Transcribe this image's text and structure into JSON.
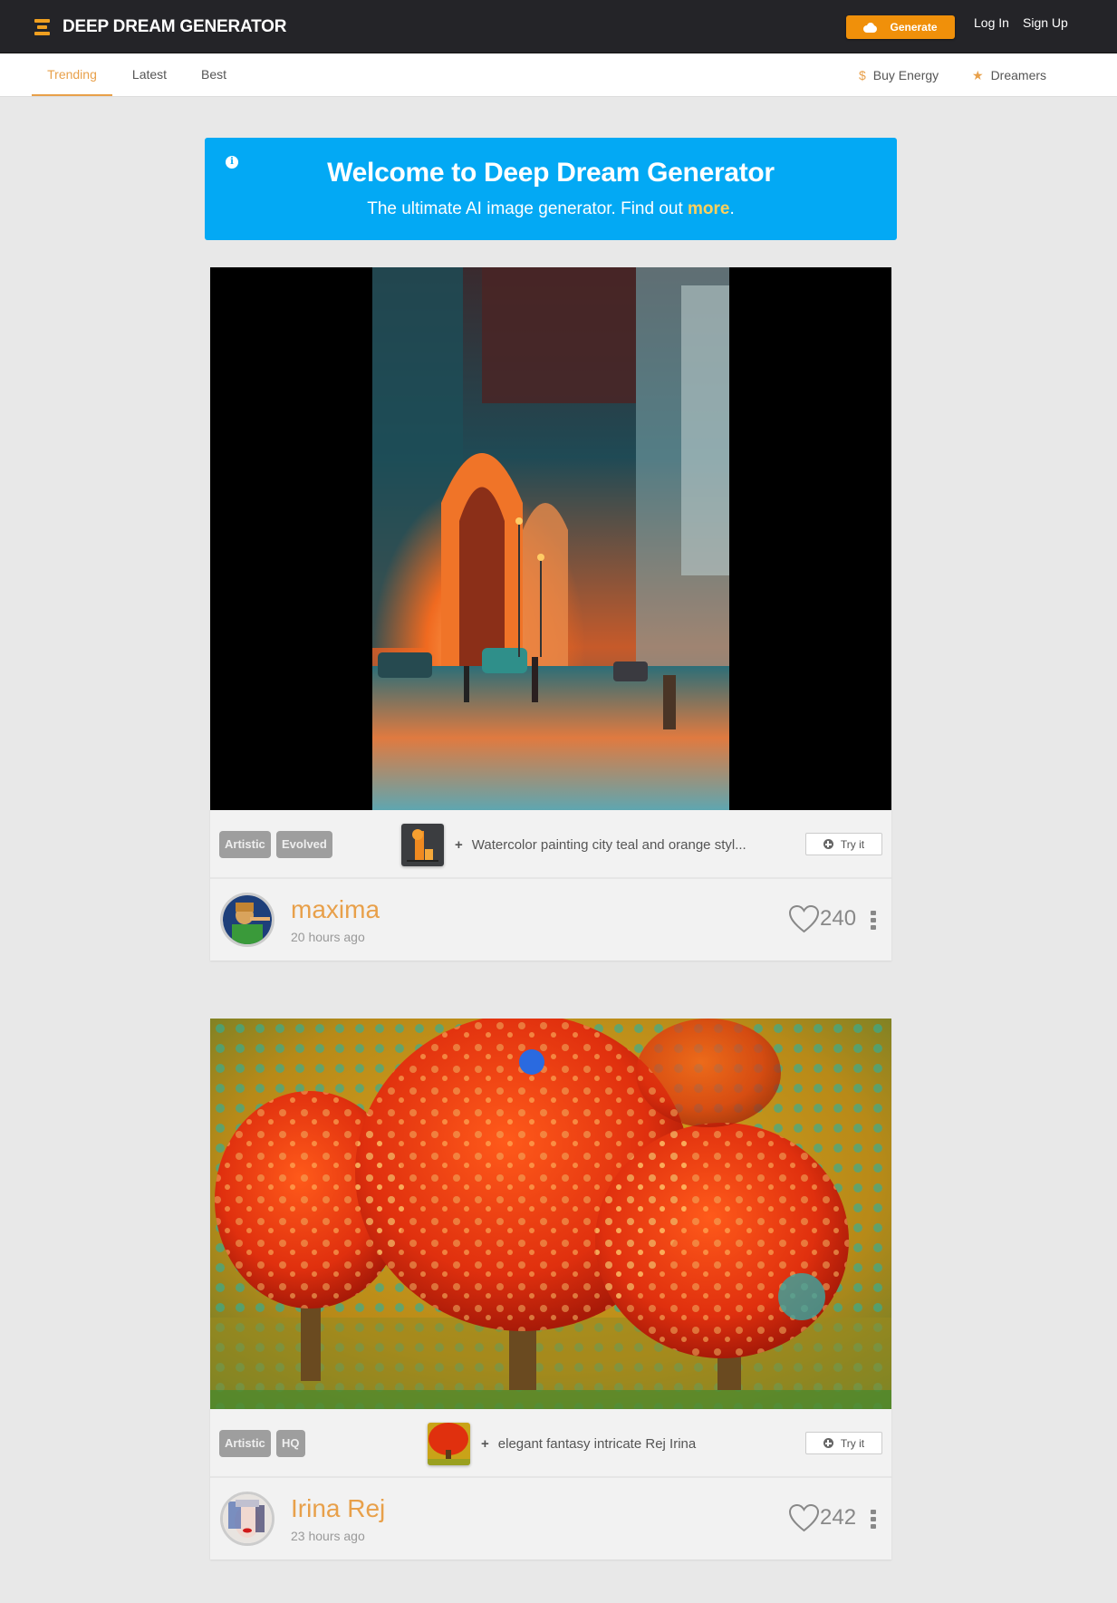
{
  "header": {
    "logo_text": "DEEP DREAM GENERATOR",
    "generate_label": "Generate",
    "login_label": "Log In",
    "signup_label": "Sign Up",
    "brand_color": "#f0900a"
  },
  "subnav": {
    "tabs": [
      {
        "label": "Trending",
        "active": true
      },
      {
        "label": "Latest",
        "active": false
      },
      {
        "label": "Best",
        "active": false
      }
    ],
    "buy_energy_label": "Buy Energy",
    "dreamers_label": "Dreamers",
    "dollar_glyph": "$",
    "star_glyph": "★"
  },
  "banner": {
    "info_glyph": "i",
    "title": "Welcome to Deep Dream Generator",
    "subtitle_prefix": "The ultimate AI image generator. Find out ",
    "subtitle_link": "more",
    "subtitle_suffix": ".",
    "background": "#03a9f4"
  },
  "posts": [
    {
      "image_alt": "Watercolor city street with teal and orange arches and vintage cars",
      "tags": [
        "Artistic",
        "Evolved"
      ],
      "prompt_plus": "+",
      "prompt": "Watercolor painting city teal and orange styl...",
      "try_label": "Try it",
      "username": "maxima",
      "time_ago": "20 hours ago",
      "likes": "240"
    },
    {
      "image_alt": "Fantasy red trees covered in glowing bubbles on golden patterned background",
      "tags": [
        "Artistic",
        "HQ"
      ],
      "prompt_plus": "+",
      "prompt": "elegant fantasy intricate Rej Irina",
      "try_label": "Try it",
      "username": "Irina Rej",
      "time_ago": "23 hours ago",
      "likes": "242"
    }
  ]
}
